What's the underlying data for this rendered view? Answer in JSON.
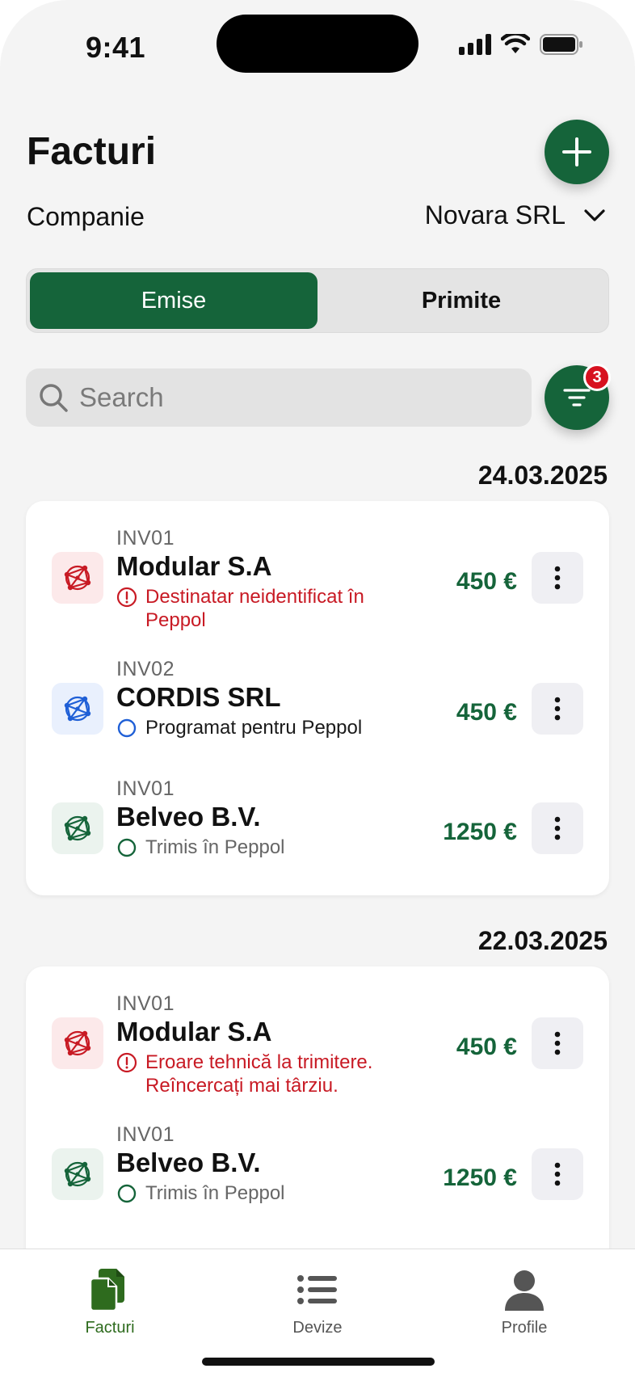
{
  "status_bar": {
    "time": "9:41"
  },
  "header": {
    "title": "Facturi"
  },
  "company": {
    "label": "Companie",
    "value": "Novara SRL"
  },
  "segments": {
    "active": "Emise",
    "inactive": "Primite"
  },
  "search": {
    "placeholder": "Search"
  },
  "filter": {
    "badge_count": "3"
  },
  "groups": [
    {
      "date": "24.03.2025",
      "items": [
        {
          "code": "INV01",
          "name": "Modular S.A",
          "amount": "450 €",
          "status_line1": "Destinatar neidentificat în",
          "status_line2": "Peppol",
          "status_type": "error"
        },
        {
          "code": "INV02",
          "name": "CORDIS SRL",
          "amount": "450 €",
          "status": "Programat pentru Peppol",
          "status_type": "scheduled"
        },
        {
          "code": "INV01",
          "name": "Belveo B.V.",
          "amount": "1250 €",
          "status": "Trimis în Peppol",
          "status_type": "sent"
        }
      ]
    },
    {
      "date": "22.03.2025",
      "items": [
        {
          "code": "INV01",
          "name": "Modular S.A",
          "amount": "450 €",
          "status_line1": "Eroare tehnică la trimitere.",
          "status_line2": "Reîncercați mai târziu.",
          "status_type": "error"
        },
        {
          "code": "INV01",
          "name": "Belveo B.V.",
          "amount": "1250 €",
          "status": "Trimis în Peppol",
          "status_type": "sent"
        }
      ]
    }
  ],
  "tabbar": {
    "facturi": "Facturi",
    "devize": "Devize",
    "profile": "Profile"
  },
  "colors": {
    "brand_green": "#15643a",
    "error_red": "#c81a24",
    "scheduled_blue": "#1f5fd6",
    "badge_red": "#d7111f"
  },
  "icons": {
    "add": "plus-icon",
    "filter": "filter-icon",
    "search": "search-icon",
    "chevron": "chevron-down-icon",
    "network": "network-globe-icon",
    "more": "more-vertical-icon",
    "tab_facturi": "documents-icon",
    "tab_devize": "list-icon",
    "tab_profile": "person-icon"
  }
}
